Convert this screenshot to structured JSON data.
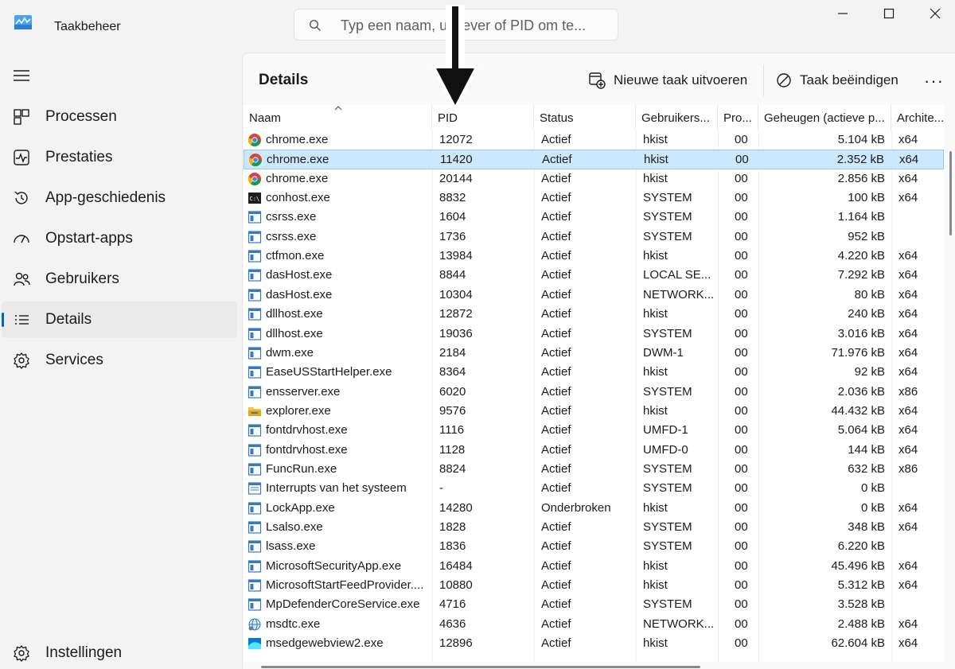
{
  "app": {
    "title": "Taakbeheer"
  },
  "search": {
    "placeholder": "Typ een naam, uitgever of PID om te..."
  },
  "sidebar": {
    "items": [
      {
        "label": "Processen",
        "icon": "processes-icon"
      },
      {
        "label": "Prestaties",
        "icon": "performance-icon"
      },
      {
        "label": "App-geschiedenis",
        "icon": "history-icon"
      },
      {
        "label": "Opstart-apps",
        "icon": "startup-icon"
      },
      {
        "label": "Gebruikers",
        "icon": "users-icon"
      },
      {
        "label": "Details",
        "icon": "details-icon",
        "active": true
      },
      {
        "label": "Services",
        "icon": "services-icon"
      }
    ],
    "settings_label": "Instellingen"
  },
  "panel": {
    "title": "Details",
    "run_task_label": "Nieuwe taak uitvoeren",
    "end_task_label": "Taak beëindigen",
    "more_label": "···"
  },
  "table": {
    "columns": [
      "Naam",
      "PID",
      "Status",
      "Gebruikers...",
      "Pro...",
      "Geheugen (actieve p...",
      "Archite..."
    ],
    "rows": [
      {
        "name": "chrome.exe",
        "pid": "12072",
        "status": "Actief",
        "user": "hkist",
        "prio": "00",
        "mem": "5.104 kB",
        "arch": "x64",
        "icon": "chrome"
      },
      {
        "name": "chrome.exe",
        "pid": "11420",
        "status": "Actief",
        "user": "hkist",
        "prio": "00",
        "mem": "2.352 kB",
        "arch": "x64",
        "icon": "chrome",
        "selected": true
      },
      {
        "name": "chrome.exe",
        "pid": "20144",
        "status": "Actief",
        "user": "hkist",
        "prio": "00",
        "mem": "2.856 kB",
        "arch": "x64",
        "icon": "chrome"
      },
      {
        "name": "conhost.exe",
        "pid": "8832",
        "status": "Actief",
        "user": "SYSTEM",
        "prio": "00",
        "mem": "100 kB",
        "arch": "x64",
        "icon": "console"
      },
      {
        "name": "csrss.exe",
        "pid": "1604",
        "status": "Actief",
        "user": "SYSTEM",
        "prio": "00",
        "mem": "1.164 kB",
        "arch": "",
        "icon": "window"
      },
      {
        "name": "csrss.exe",
        "pid": "1736",
        "status": "Actief",
        "user": "SYSTEM",
        "prio": "00",
        "mem": "952 kB",
        "arch": "",
        "icon": "window"
      },
      {
        "name": "ctfmon.exe",
        "pid": "13984",
        "status": "Actief",
        "user": "hkist",
        "prio": "00",
        "mem": "4.220 kB",
        "arch": "x64",
        "icon": "window"
      },
      {
        "name": "dasHost.exe",
        "pid": "8844",
        "status": "Actief",
        "user": "LOCAL SE...",
        "prio": "00",
        "mem": "7.292 kB",
        "arch": "x64",
        "icon": "window"
      },
      {
        "name": "dasHost.exe",
        "pid": "10304",
        "status": "Actief",
        "user": "NETWORK...",
        "prio": "00",
        "mem": "80 kB",
        "arch": "x64",
        "icon": "window"
      },
      {
        "name": "dllhost.exe",
        "pid": "12872",
        "status": "Actief",
        "user": "hkist",
        "prio": "00",
        "mem": "240 kB",
        "arch": "x64",
        "icon": "window"
      },
      {
        "name": "dllhost.exe",
        "pid": "19036",
        "status": "Actief",
        "user": "SYSTEM",
        "prio": "00",
        "mem": "3.016 kB",
        "arch": "x64",
        "icon": "window"
      },
      {
        "name": "dwm.exe",
        "pid": "2184",
        "status": "Actief",
        "user": "DWM-1",
        "prio": "00",
        "mem": "71.976 kB",
        "arch": "x64",
        "icon": "window"
      },
      {
        "name": "EaseUSStartHelper.exe",
        "pid": "8364",
        "status": "Actief",
        "user": "hkist",
        "prio": "00",
        "mem": "92 kB",
        "arch": "x64",
        "icon": "window"
      },
      {
        "name": "ensserver.exe",
        "pid": "6020",
        "status": "Actief",
        "user": "SYSTEM",
        "prio": "00",
        "mem": "2.036 kB",
        "arch": "x86",
        "icon": "window"
      },
      {
        "name": "explorer.exe",
        "pid": "9576",
        "status": "Actief",
        "user": "hkist",
        "prio": "00",
        "mem": "44.432 kB",
        "arch": "x64",
        "icon": "folder"
      },
      {
        "name": "fontdrvhost.exe",
        "pid": "1116",
        "status": "Actief",
        "user": "UMFD-1",
        "prio": "00",
        "mem": "5.064 kB",
        "arch": "x64",
        "icon": "window"
      },
      {
        "name": "fontdrvhost.exe",
        "pid": "1128",
        "status": "Actief",
        "user": "UMFD-0",
        "prio": "00",
        "mem": "144 kB",
        "arch": "x64",
        "icon": "window"
      },
      {
        "name": "FuncRun.exe",
        "pid": "8824",
        "status": "Actief",
        "user": "SYSTEM",
        "prio": "00",
        "mem": "632 kB",
        "arch": "x86",
        "icon": "window"
      },
      {
        "name": "Interrupts van het systeem",
        "pid": "-",
        "status": "Actief",
        "user": "SYSTEM",
        "prio": "00",
        "mem": "0 kB",
        "arch": "",
        "icon": "window-list"
      },
      {
        "name": "LockApp.exe",
        "pid": "14280",
        "status": "Onderbroken",
        "user": "hkist",
        "prio": "00",
        "mem": "0 kB",
        "arch": "x64",
        "icon": "window"
      },
      {
        "name": "Lsalso.exe",
        "pid": "1828",
        "status": "Actief",
        "user": "SYSTEM",
        "prio": "00",
        "mem": "348 kB",
        "arch": "x64",
        "icon": "window"
      },
      {
        "name": "lsass.exe",
        "pid": "1836",
        "status": "Actief",
        "user": "SYSTEM",
        "prio": "00",
        "mem": "6.220 kB",
        "arch": "",
        "icon": "window"
      },
      {
        "name": "MicrosoftSecurityApp.exe",
        "pid": "16484",
        "status": "Actief",
        "user": "hkist",
        "prio": "00",
        "mem": "45.496 kB",
        "arch": "x64",
        "icon": "window"
      },
      {
        "name": "MicrosoftStartFeedProvider....",
        "pid": "10880",
        "status": "Actief",
        "user": "hkist",
        "prio": "00",
        "mem": "5.312 kB",
        "arch": "x64",
        "icon": "window"
      },
      {
        "name": "MpDefenderCoreService.exe",
        "pid": "4716",
        "status": "Actief",
        "user": "SYSTEM",
        "prio": "00",
        "mem": "3.528 kB",
        "arch": "",
        "icon": "window"
      },
      {
        "name": "msdtc.exe",
        "pid": "4636",
        "status": "Actief",
        "user": "NETWORK...",
        "prio": "00",
        "mem": "2.488 kB",
        "arch": "x64",
        "icon": "network"
      },
      {
        "name": "msedgewebview2.exe",
        "pid": "12896",
        "status": "Actief",
        "user": "hkist",
        "prio": "00",
        "mem": "62.604 kB",
        "arch": "x64",
        "icon": "webview"
      }
    ]
  },
  "colors": {
    "accent": "#0067c0",
    "selection": "#cce8ff",
    "selection_border": "#99c9f0"
  }
}
